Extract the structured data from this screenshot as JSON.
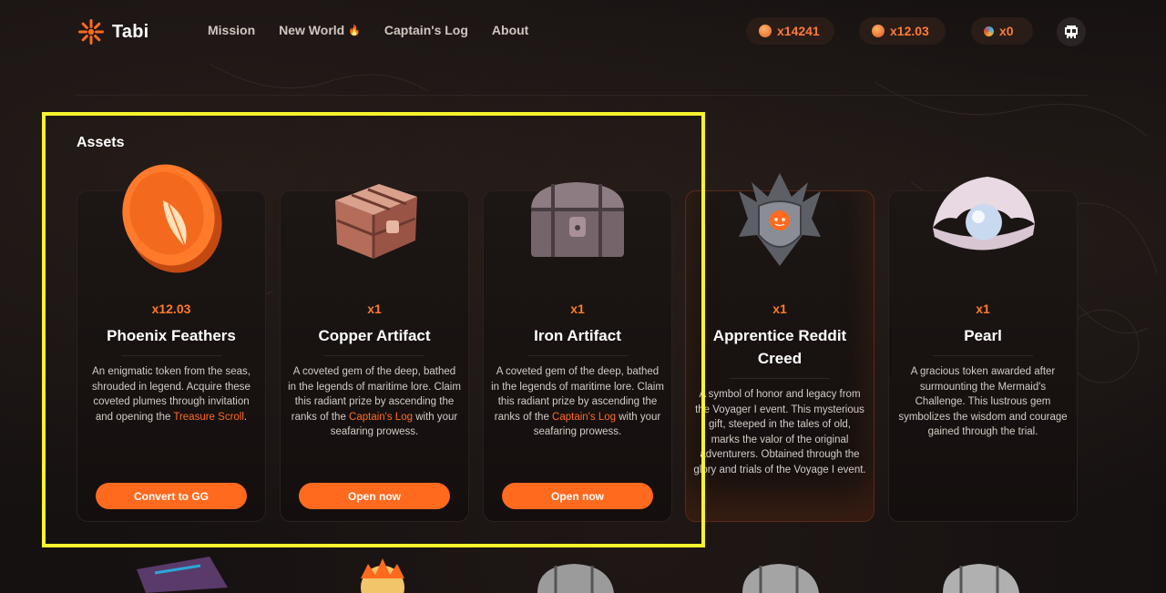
{
  "header": {
    "brand": "Tabi",
    "nav": [
      {
        "label": "Mission"
      },
      {
        "label": "New World",
        "icon": "flame-icon"
      },
      {
        "label": "Captain's Log"
      },
      {
        "label": "About"
      }
    ],
    "balances": {
      "coins": "x14241",
      "feathers": "x12.03",
      "gems": "x0"
    },
    "accent_color": "#ff6a1e"
  },
  "assets": {
    "title": "Assets",
    "cards": [
      {
        "icon": "phoenix-feather-coin-icon",
        "qty": "x12.03",
        "name": "Phoenix Feathers",
        "desc_parts": [
          "An enigmatic token from the seas, shrouded in legend. Acquire these coveted plumes through invitation and opening the ",
          "Treasure Scroll",
          "."
        ],
        "button": "Convert to GG"
      },
      {
        "icon": "copper-chest-icon",
        "qty": "x1",
        "name": "Copper Artifact",
        "desc_parts": [
          "A coveted gem of the deep, bathed in the legends of maritime lore. Claim this radiant prize by ascending the ranks of the ",
          "Captain's Log",
          " with your seafaring prowess."
        ],
        "button": "Open now"
      },
      {
        "icon": "iron-chest-icon",
        "qty": "x1",
        "name": "Iron Artifact",
        "desc_parts": [
          "A coveted gem of the deep, bathed in the legends of maritime lore. Claim this radiant prize by ascending the ranks of the ",
          "Captain's Log",
          " with your seafaring prowess."
        ],
        "button": "Open now"
      },
      {
        "icon": "reddit-crest-icon",
        "qty": "x1",
        "name": "Apprentice Reddit Creed",
        "desc": "A symbol of honor and legacy from the Voyager I event. This mysterious gift, steeped in the tales of old, marks the valor of the original adventurers. Obtained through the glory and trials of the Voyage I event."
      },
      {
        "icon": "pearl-shell-icon",
        "qty": "x1",
        "name": "Pearl",
        "desc": "A gracious token awarded after surmounting the Mermaid's Challenge. This lustrous gem symbolizes the wisdom and courage gained through the trial."
      }
    ]
  }
}
